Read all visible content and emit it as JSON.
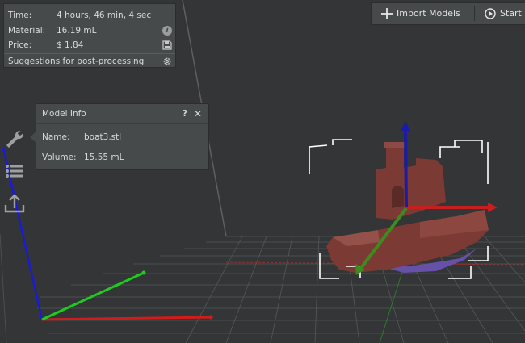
{
  "estimate": {
    "time_label": "Time:",
    "time_value": "4 hours, 46 min, 4 sec",
    "material_label": "Material:",
    "material_value": "16.19 mL",
    "price_label": "Price:",
    "price_value": "$ 1.84",
    "suggestions_label": "Suggestions for post-processing"
  },
  "toolbar": {
    "import_label": "Import Models",
    "start_label": "Start Sl"
  },
  "model_info": {
    "title": "Model Info",
    "help_label": "?",
    "close_label": "✕",
    "name_label": "Name:",
    "name_value": "boat3.stl",
    "volume_label": "Volume:",
    "volume_value": "15.55 mL"
  },
  "icons": {
    "material_info": "info-icon",
    "price_save": "save-icon",
    "suggestions": "gear-icon",
    "import": "plus-icon",
    "start": "play-icon",
    "tool_1": "wrench-icon",
    "tool_2": "list-icon",
    "tool_3": "export-icon"
  },
  "colors": {
    "background": "#333536",
    "panel": "#474a4b",
    "axis_x": "#d21c1c",
    "axis_y": "#1ecc1e",
    "axis_z": "#1a1ad8",
    "model": "#7b3a34",
    "model_support": "#6650a8"
  }
}
